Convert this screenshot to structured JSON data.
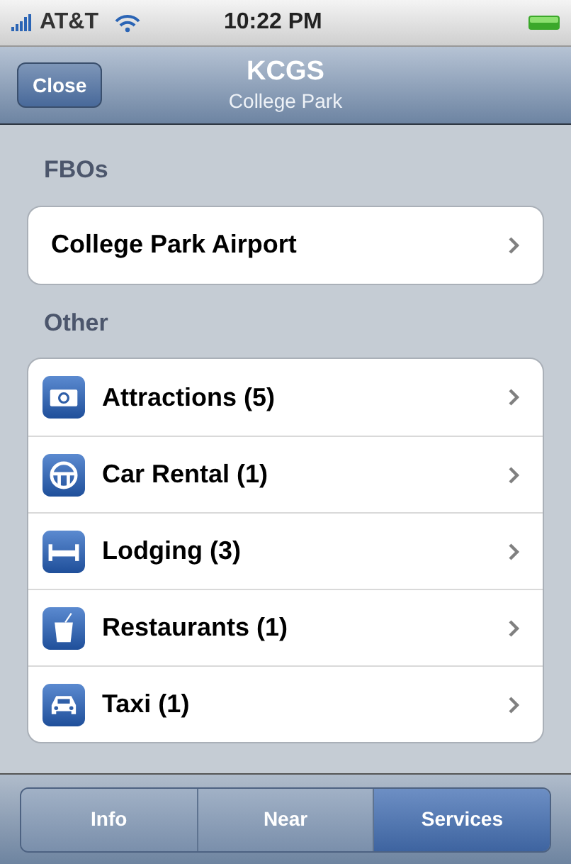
{
  "status_bar": {
    "carrier": "AT&T",
    "time": "10:22 PM"
  },
  "nav_bar": {
    "back_button": "Close",
    "title": "KCGS",
    "subtitle": "College Park"
  },
  "sections": [
    {
      "header": "FBOs",
      "items": [
        {
          "label": "College Park Airport",
          "kind": "plain"
        }
      ]
    },
    {
      "header": "Other",
      "items": [
        {
          "label": "Attractions (5)",
          "kind": "camera"
        },
        {
          "label": "Car Rental (1)",
          "kind": "wheel"
        },
        {
          "label": "Lodging (3)",
          "kind": "bed"
        },
        {
          "label": "Restaurants (1)",
          "kind": "cup"
        },
        {
          "label": "Taxi (1)",
          "kind": "car"
        }
      ]
    }
  ],
  "tabs": [
    {
      "label": "Info",
      "selected": false
    },
    {
      "label": "Near",
      "selected": false
    },
    {
      "label": "Services",
      "selected": true
    }
  ]
}
